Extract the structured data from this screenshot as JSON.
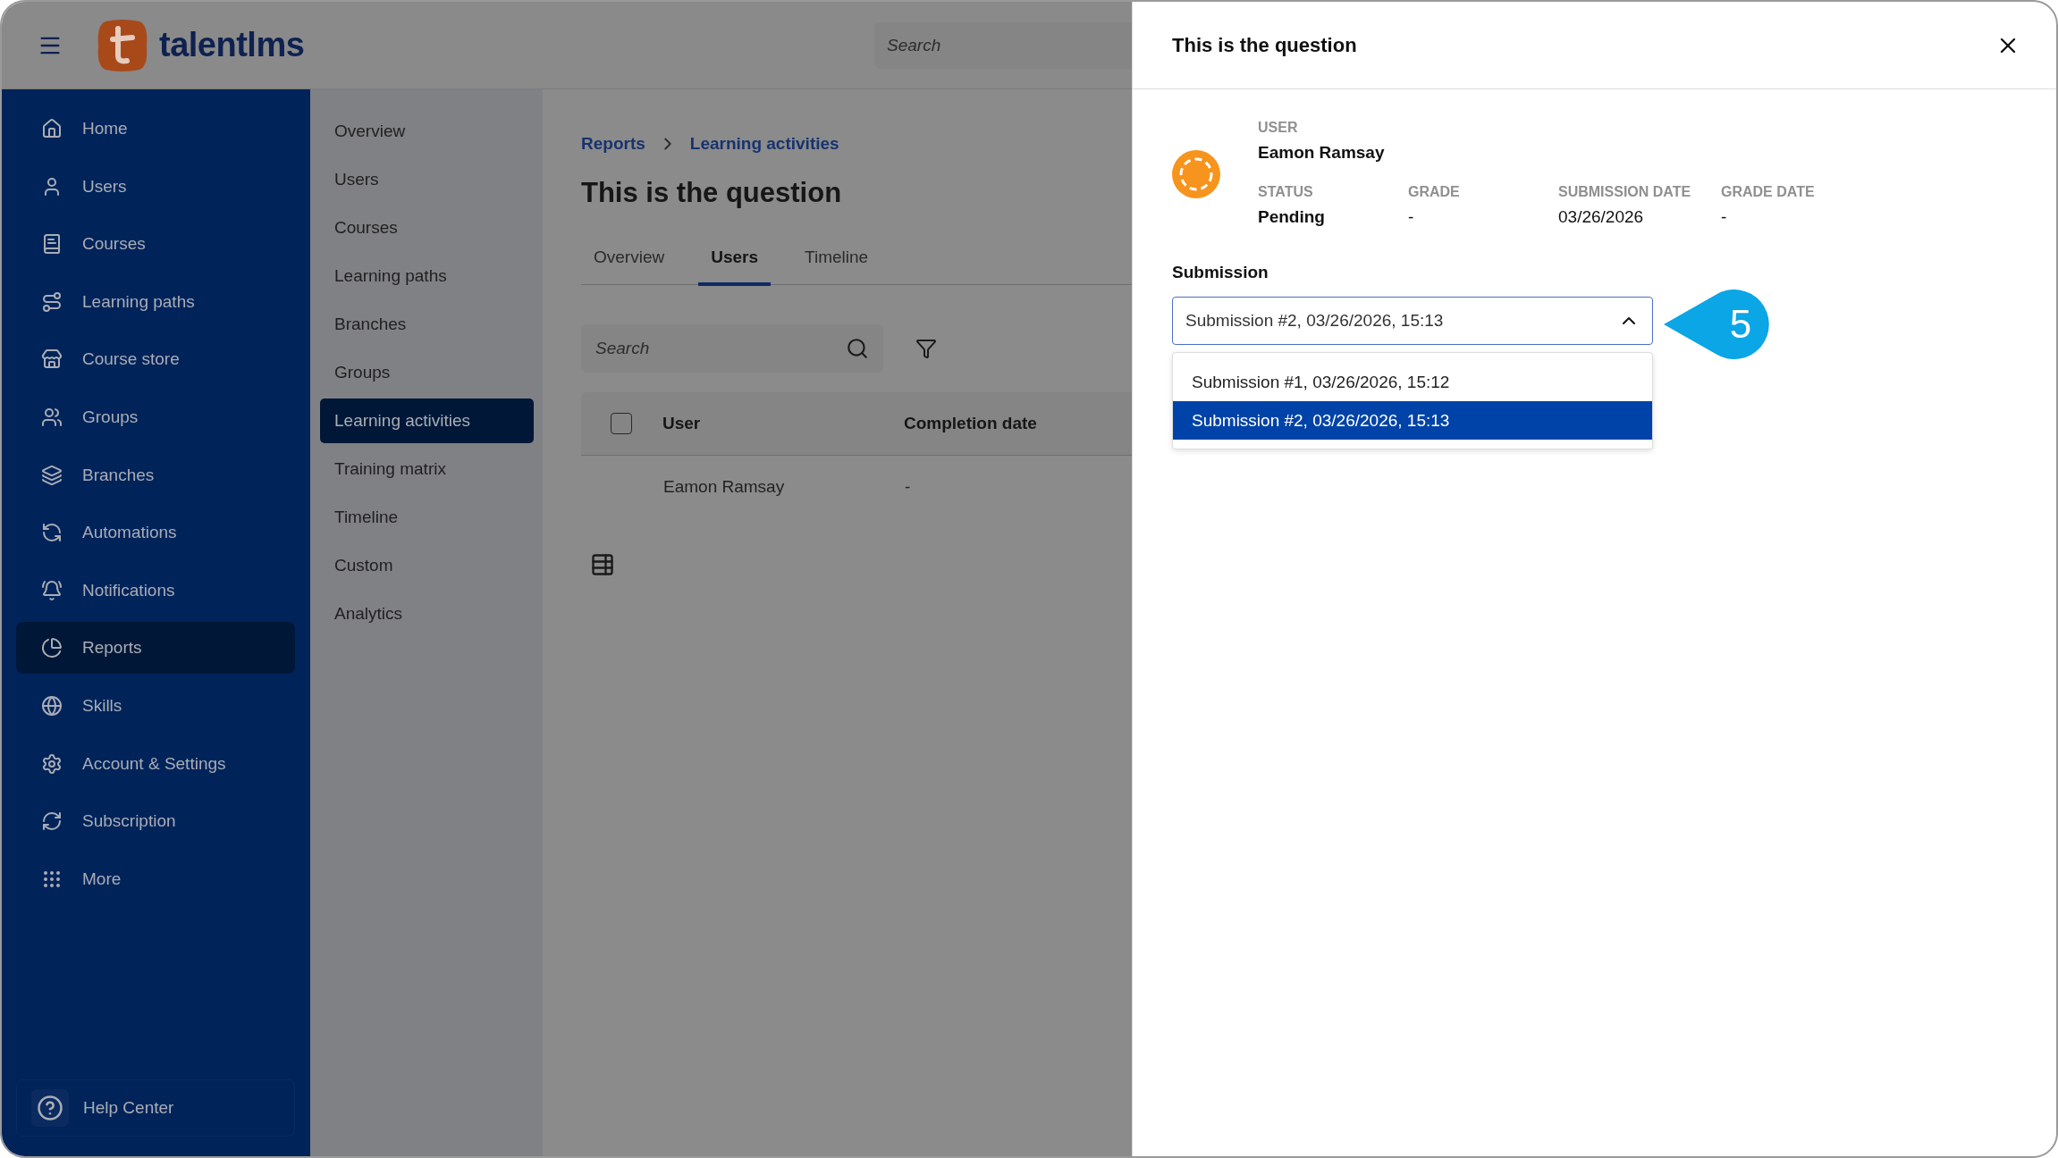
{
  "header": {
    "logo_text": "talentlms",
    "search": {
      "placeholder": "Search"
    }
  },
  "sidebar": {
    "items": [
      {
        "label": "Home",
        "selected": false
      },
      {
        "label": "Users",
        "selected": false
      },
      {
        "label": "Courses",
        "selected": false
      },
      {
        "label": "Learning paths",
        "selected": false
      },
      {
        "label": "Course store",
        "selected": false
      },
      {
        "label": "Groups",
        "selected": false
      },
      {
        "label": "Branches",
        "selected": false
      },
      {
        "label": "Automations",
        "selected": false
      },
      {
        "label": "Notifications",
        "selected": false
      },
      {
        "label": "Reports",
        "selected": true
      },
      {
        "label": "Skills",
        "selected": false
      },
      {
        "label": "Account & Settings",
        "selected": false
      },
      {
        "label": "Subscription",
        "selected": false
      },
      {
        "label": "More",
        "selected": false
      }
    ],
    "help": "Help Center"
  },
  "subnav": {
    "items": [
      {
        "label": "Overview",
        "selected": false
      },
      {
        "label": "Users",
        "selected": false
      },
      {
        "label": "Courses",
        "selected": false
      },
      {
        "label": "Learning paths",
        "selected": false
      },
      {
        "label": "Branches",
        "selected": false
      },
      {
        "label": "Groups",
        "selected": false
      },
      {
        "label": "Learning activities",
        "selected": true
      },
      {
        "label": "Training matrix",
        "selected": false
      },
      {
        "label": "Timeline",
        "selected": false
      },
      {
        "label": "Custom",
        "selected": false
      },
      {
        "label": "Analytics",
        "selected": false
      }
    ]
  },
  "main": {
    "breadcrumb": [
      "Reports",
      "Learning activities"
    ],
    "title": "This is the question",
    "tabs": [
      {
        "label": "Overview",
        "selected": false
      },
      {
        "label": "Users",
        "selected": true
      },
      {
        "label": "Timeline",
        "selected": false
      }
    ],
    "search": {
      "placeholder": "Search"
    },
    "table": {
      "select_all": {
        "checked": false
      },
      "columns": [
        "User",
        "Completion date"
      ],
      "rows": [
        {
          "cells": [
            "Eamon Ramsay",
            "-"
          ]
        }
      ]
    }
  },
  "drawer": {
    "title": "This is the question",
    "user_label": "USER",
    "user_name": "Eamon Ramsay",
    "fields": [
      {
        "label": "STATUS",
        "value": "Pending",
        "bold": true
      },
      {
        "label": "GRADE",
        "value": "-",
        "bold": false
      },
      {
        "label": "SUBMISSION DATE",
        "value": "03/26/2026",
        "bold": false
      },
      {
        "label": "GRADE DATE",
        "value": "-",
        "bold": false
      }
    ],
    "submission_label": "Submission",
    "select": {
      "value": "Submission #2, 03/26/2026, 15:13",
      "expanded": true,
      "options": [
        {
          "label": "Submission #1, 03/26/2026, 15:12",
          "selected": false
        },
        {
          "label": "Submission #2, 03/26/2026, 15:13",
          "selected": true
        }
      ]
    },
    "callout": "5"
  }
}
